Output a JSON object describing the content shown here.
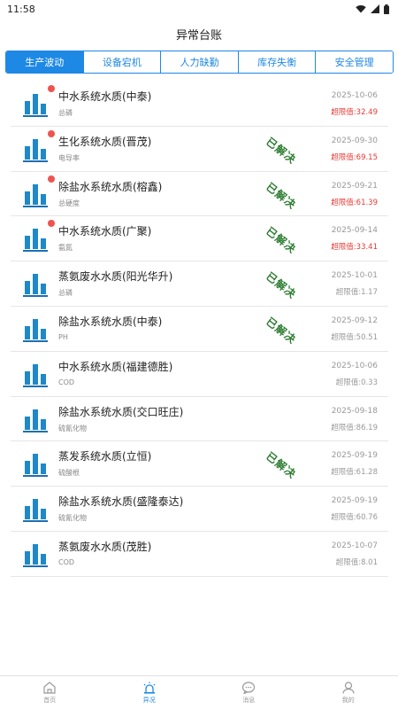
{
  "status_bar": {
    "time": "11:58"
  },
  "header": {
    "title": "异常台账"
  },
  "tabs": [
    {
      "label": "生产波动",
      "active": true
    },
    {
      "label": "设备宕机",
      "active": false
    },
    {
      "label": "人力缺勤",
      "active": false
    },
    {
      "label": "库存失衡",
      "active": false
    },
    {
      "label": "安全管理",
      "active": false
    }
  ],
  "items": [
    {
      "title": "中水系统水质(中泰)",
      "param": "总磷",
      "date": "2025-10-06",
      "limit": "超限值:32.49",
      "unread": true,
      "resolved": false,
      "limit_alert": true
    },
    {
      "title": "生化系统水质(晋茂)",
      "param": "电导率",
      "date": "2025-09-30",
      "limit": "超限值:69.15",
      "unread": true,
      "resolved": true,
      "limit_alert": true
    },
    {
      "title": "除盐水系统水质(榕鑫)",
      "param": "总硬度",
      "date": "2025-09-21",
      "limit": "超限值:61.39",
      "unread": true,
      "resolved": true,
      "limit_alert": true
    },
    {
      "title": "中水系统水质(广聚)",
      "param": "氨氮",
      "date": "2025-09-14",
      "limit": "超限值:33.41",
      "unread": true,
      "resolved": true,
      "limit_alert": true
    },
    {
      "title": "蒸氨废水水质(阳光华升)",
      "param": "总磷",
      "date": "2025-10-01",
      "limit": "超限值:1.17",
      "unread": false,
      "resolved": true,
      "limit_alert": false
    },
    {
      "title": "除盐水系统水质(中泰)",
      "param": "PH",
      "date": "2025-09-12",
      "limit": "超限值:50.51",
      "unread": false,
      "resolved": true,
      "limit_alert": false
    },
    {
      "title": "中水系统水质(福建德胜)",
      "param": "COD",
      "date": "2025-10-06",
      "limit": "超限值:0.33",
      "unread": false,
      "resolved": false,
      "limit_alert": false
    },
    {
      "title": "除盐水系统水质(交口旺庄)",
      "param": "硫氰化物",
      "date": "2025-09-18",
      "limit": "超限值:86.19",
      "unread": false,
      "resolved": false,
      "limit_alert": false
    },
    {
      "title": "蒸发系统水质(立恒)",
      "param": "硫酸根",
      "date": "2025-09-19",
      "limit": "超限值:61.28",
      "unread": false,
      "resolved": true,
      "limit_alert": false
    },
    {
      "title": "除盐水系统水质(盛隆泰达)",
      "param": "硫氰化物",
      "date": "2025-09-19",
      "limit": "超限值:60.76",
      "unread": false,
      "resolved": false,
      "limit_alert": false
    },
    {
      "title": "蒸氨废水水质(茂胜)",
      "param": "COD",
      "date": "2025-10-07",
      "limit": "超限值:8.01",
      "unread": false,
      "resolved": false,
      "limit_alert": false
    }
  ],
  "resolved_label": "已解决",
  "bottom_nav": [
    {
      "label": "首页",
      "icon": "home-icon",
      "active": false
    },
    {
      "label": "异况",
      "icon": "alarm-icon",
      "active": true
    },
    {
      "label": "消息",
      "icon": "message-icon",
      "active": false
    },
    {
      "label": "我的",
      "icon": "profile-icon",
      "active": false
    }
  ],
  "colors": {
    "accent": "#1e88e5",
    "alert": "#e53935",
    "resolved": "#2e7d32",
    "unread_dot": "#ef5350"
  }
}
